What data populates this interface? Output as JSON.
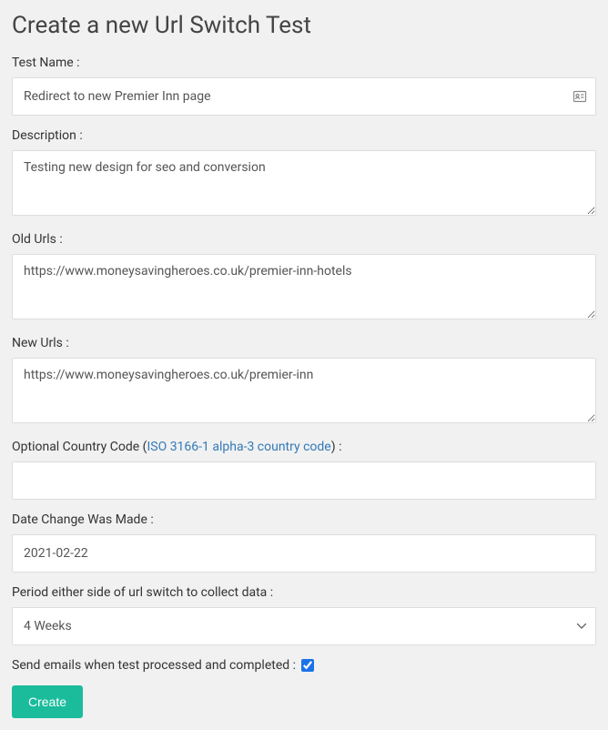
{
  "page_title": "Create a new Url Switch Test",
  "fields": {
    "test_name": {
      "label": "Test Name :",
      "value": "Redirect to new Premier Inn page"
    },
    "description": {
      "label": "Description :",
      "value": "Testing new design for seo and conversion"
    },
    "old_urls": {
      "label": "Old Urls :",
      "value": "https://www.moneysavingheroes.co.uk/premier-inn-hotels"
    },
    "new_urls": {
      "label": "New Urls :",
      "value": "https://www.moneysavingheroes.co.uk/premier-inn"
    },
    "country_code": {
      "label_pre": "Optional Country Code (",
      "link_text": "ISO 3166-1 alpha-3 country code",
      "label_post": ") :",
      "value": ""
    },
    "date_change": {
      "label": "Date Change Was Made :",
      "value": "2021-02-22"
    },
    "period": {
      "label": "Period either side of url switch to collect data :",
      "value": "4 Weeks"
    },
    "send_emails": {
      "label": "Send emails when test processed and completed :",
      "checked": true
    }
  },
  "create_button": "Create"
}
